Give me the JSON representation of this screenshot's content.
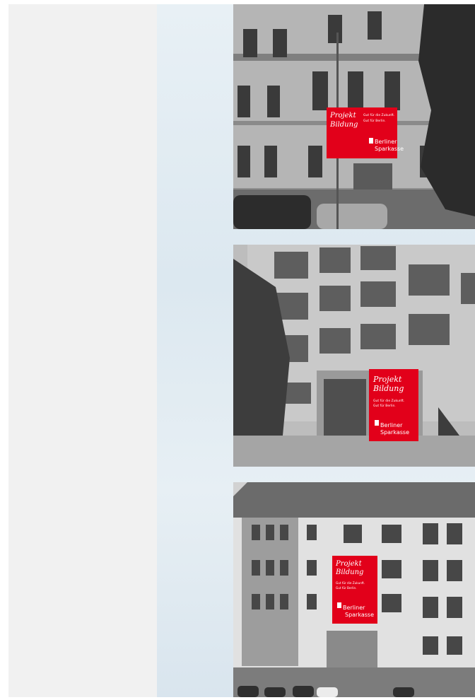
{
  "banners": [
    {
      "headline_line1": "Projekt",
      "headline_line2": "Bildung",
      "slogan_line1": "Gut für die Zukunft.",
      "slogan_line2": "Gut für Berlin.",
      "brand_line1": "Berliner",
      "brand_line2": "Sparkasse"
    },
    {
      "headline_line1": "Projekt",
      "headline_line2": "Bildung",
      "slogan_line1": "Gut für die Zukunft.",
      "slogan_line2": "Gut für Berlin.",
      "brand_line1": "Berliner",
      "brand_line2": "Sparkasse"
    },
    {
      "headline_line1": "Projekt",
      "headline_line2": "Bildung",
      "slogan_line1": "Gut für die Zukunft.",
      "slogan_line2": "Gut für Berlin.",
      "brand_line1": "Berliner",
      "brand_line2": "Sparkasse"
    }
  ],
  "colors": {
    "banner_red": "#e2001a",
    "background_blue": "#dfe9f0",
    "left_panel_gray": "#f1f1f1"
  }
}
